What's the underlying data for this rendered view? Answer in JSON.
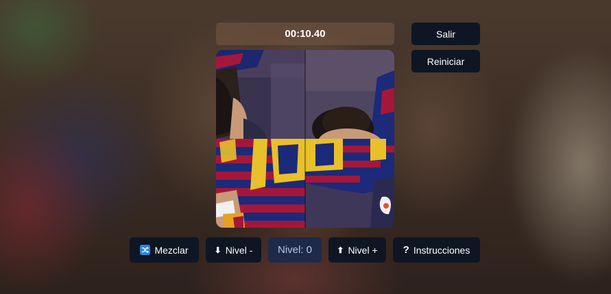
{
  "timer": "00:10.40",
  "side_buttons": {
    "exit_label": "Salir",
    "restart_label": "Reiniciar"
  },
  "puzzle": {
    "tiles": [
      {
        "name": "puzzle-tile-top-left"
      },
      {
        "name": "puzzle-tile-top-right"
      },
      {
        "name": "puzzle-tile-bottom-left"
      },
      {
        "name": "puzzle-tile-bottom-right"
      }
    ]
  },
  "controls": {
    "shuffle_label": "Mezclar",
    "shuffle_icon": "shuffle-icon",
    "level_down_label": "Nivel -",
    "level_down_icon": "arrow-down-icon",
    "level_display": "Nivel: 0",
    "level_up_label": "Nivel +",
    "level_up_icon": "arrow-up-icon",
    "instructions_label": "Instrucciones",
    "instructions_icon": "question-icon"
  },
  "colors": {
    "button_bg": "#0f1623",
    "level_bg": "#1d2a4a",
    "accent_blue": "#2f86e0",
    "jersey_red": "#a5173a",
    "jersey_blue": "#1b2a7a",
    "number_gold": "#e8c02a"
  }
}
